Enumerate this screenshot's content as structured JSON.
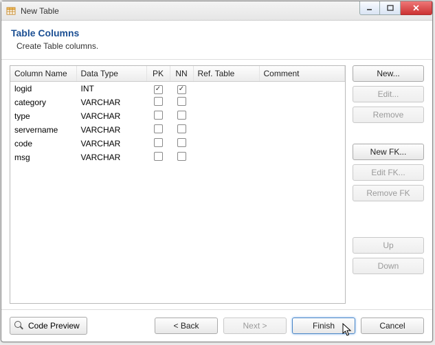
{
  "window": {
    "title": "New Table"
  },
  "header": {
    "title": "Table Columns",
    "subtitle": "Create Table columns."
  },
  "table": {
    "headers": {
      "name": "Column Name",
      "type": "Data Type",
      "pk": "PK",
      "nn": "NN",
      "ref": "Ref. Table",
      "comment": "Comment"
    },
    "rows": [
      {
        "name": "logid",
        "type": "INT",
        "pk": true,
        "nn": true,
        "ref": "",
        "comment": ""
      },
      {
        "name": "category",
        "type": "VARCHAR",
        "pk": false,
        "nn": false,
        "ref": "",
        "comment": ""
      },
      {
        "name": "type",
        "type": "VARCHAR",
        "pk": false,
        "nn": false,
        "ref": "",
        "comment": ""
      },
      {
        "name": "servername",
        "type": "VARCHAR",
        "pk": false,
        "nn": false,
        "ref": "",
        "comment": ""
      },
      {
        "name": "code",
        "type": "VARCHAR",
        "pk": false,
        "nn": false,
        "ref": "",
        "comment": ""
      },
      {
        "name": "msg",
        "type": "VARCHAR",
        "pk": false,
        "nn": false,
        "ref": "",
        "comment": ""
      }
    ],
    "blank_rows": 10
  },
  "side_buttons": {
    "new": "New...",
    "edit": "Edit...",
    "remove": "Remove",
    "new_fk": "New FK...",
    "edit_fk": "Edit FK...",
    "remove_fk": "Remove FK",
    "up": "Up",
    "down": "Down"
  },
  "footer": {
    "code_preview": "Code Preview",
    "back": "< Back",
    "next": "Next >",
    "finish": "Finish",
    "cancel": "Cancel"
  }
}
